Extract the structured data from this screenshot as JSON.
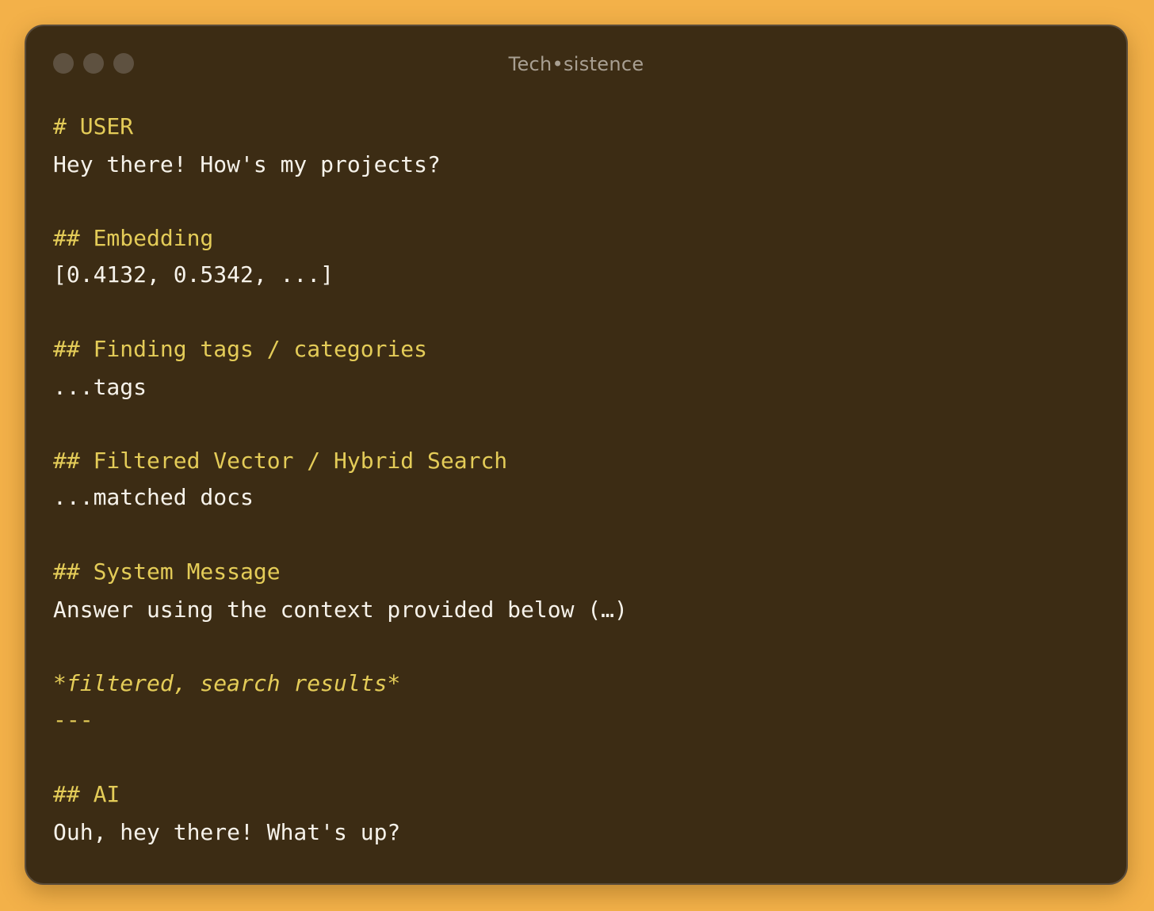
{
  "window": {
    "title": "Tech•sistence"
  },
  "lines": {
    "user_heading": "# USER",
    "user_text": "Hey there! How's my projects?",
    "embedding_heading": "## Embedding",
    "embedding_text": "[0.4132, 0.5342, ...]",
    "tags_heading": "## Finding tags / categories",
    "tags_text": "...tags",
    "search_heading": "## Filtered Vector / Hybrid Search",
    "search_text": "...matched docs",
    "system_heading": "## System Message",
    "system_text": "Answer using the context provided below (…)",
    "filtered_text": "*filtered, search results*",
    "separator": "---",
    "ai_heading": "## AI",
    "ai_text": "Ouh, hey there! What's up?"
  }
}
